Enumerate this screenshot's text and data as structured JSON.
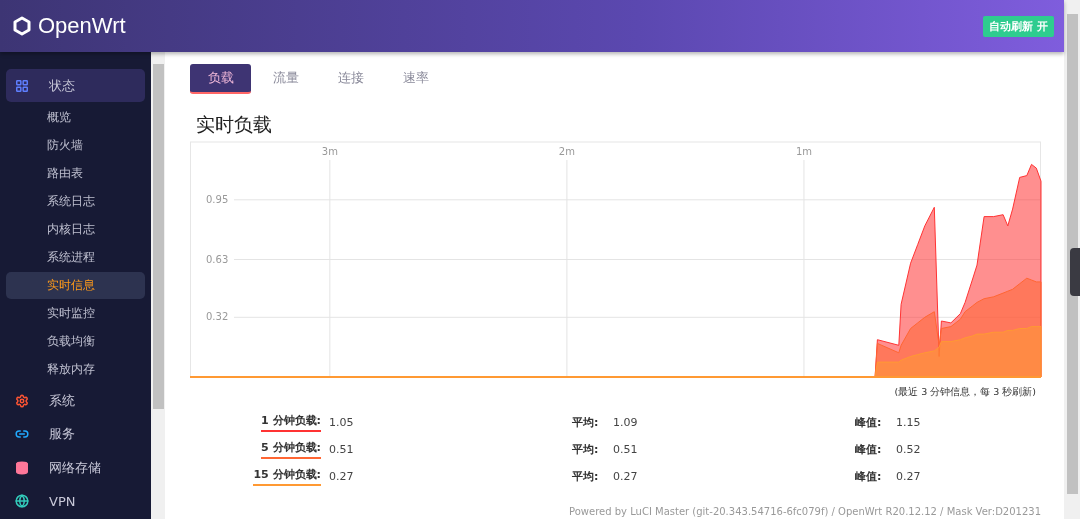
{
  "header": {
    "logo": "OpenWrt",
    "refresh_button": {
      "label": "自动刷新 开",
      "on": true
    }
  },
  "sidebar": {
    "items": [
      {
        "label": "状态",
        "kind": "grid",
        "expanded": true,
        "children": [
          {
            "label": "概览",
            "selected": false
          },
          {
            "label": "防火墙",
            "selected": false
          },
          {
            "label": "路由表",
            "selected": false
          },
          {
            "label": "系统日志",
            "selected": false
          },
          {
            "label": "内核日志",
            "selected": false
          },
          {
            "label": "系统进程",
            "selected": false
          },
          {
            "label": "实时信息",
            "selected": true
          },
          {
            "label": "实时监控",
            "selected": false
          },
          {
            "label": "负载均衡",
            "selected": false
          },
          {
            "label": "释放内存",
            "selected": false
          }
        ]
      },
      {
        "label": "系统",
        "kind": "gear",
        "expanded": false
      },
      {
        "label": "服务",
        "kind": "link",
        "expanded": false
      },
      {
        "label": "网络存储",
        "kind": "database",
        "expanded": false
      },
      {
        "label": "VPN",
        "kind": "globe",
        "expanded": false
      }
    ]
  },
  "tabs": [
    {
      "label": "负载",
      "selected": true
    },
    {
      "label": "流量",
      "selected": false
    },
    {
      "label": "连接",
      "selected": false
    },
    {
      "label": "速率",
      "selected": false
    }
  ],
  "title": "实时负载",
  "chart_data": {
    "type": "area",
    "grid": true,
    "xlim": [
      3.59,
      0
    ],
    "ylim": [
      0,
      1.26
    ],
    "xticks": [
      {
        "value": 3,
        "label": "3m"
      },
      {
        "value": 2,
        "label": "2m"
      },
      {
        "value": 1,
        "label": "1m"
      }
    ],
    "yticks": [
      {
        "value": 0.32,
        "label": "0.32"
      },
      {
        "value": 0.63,
        "label": "0.63"
      },
      {
        "value": 0.95,
        "label": "0.95"
      }
    ],
    "x": [
      3.59,
      0.7,
      0.69,
      0.6,
      0.59,
      0.55,
      0.52,
      0.49,
      0.45,
      0.43,
      0.42,
      0.38,
      0.34,
      0.32,
      0.29,
      0.27,
      0.24,
      0.2,
      0.16,
      0.14,
      0.12,
      0.09,
      0.06,
      0.04,
      0.02,
      0
    ],
    "series": [
      {
        "color": "#ff3333",
        "values": [
          0,
          0,
          0.2,
          0.17,
          0.39,
          0.61,
          0.71,
          0.81,
          0.91,
          0.11,
          0.3,
          0.29,
          0.34,
          0.4,
          0.52,
          0.6,
          0.86,
          0.86,
          0.87,
          0.81,
          0.9,
          1.07,
          1.08,
          1.14,
          1.12,
          1.05
        ]
      },
      {
        "color": "#ff6633",
        "values": [
          0,
          0,
          0.18,
          0.13,
          0.17,
          0.26,
          0.29,
          0.32,
          0.35,
          0.17,
          0.26,
          0.27,
          0.31,
          0.35,
          0.38,
          0.4,
          0.42,
          0.43,
          0.45,
          0.46,
          0.47,
          0.5,
          0.53,
          0.52,
          0.51,
          0.51
        ]
      },
      {
        "color": "#ff9933",
        "values": [
          0,
          0,
          0.08,
          0.08,
          0.09,
          0.11,
          0.12,
          0.13,
          0.14,
          0.16,
          0.19,
          0.19,
          0.2,
          0.21,
          0.22,
          0.23,
          0.23,
          0.24,
          0.24,
          0.25,
          0.25,
          0.26,
          0.26,
          0.27,
          0.27,
          0.27
        ]
      }
    ]
  },
  "chart_note": "(最近 3 分钟信息，每 3 秒刷新)",
  "stats": [
    {
      "label": "1 分钟负载:",
      "value": "1.05",
      "avg_label": "平均:",
      "avg": "1.09",
      "peak_label": "峰值:",
      "peak": "1.15",
      "color": "#ff3333"
    },
    {
      "label": "5 分钟负载:",
      "value": "0.51",
      "avg_label": "平均:",
      "avg": "0.51",
      "peak_label": "峰值:",
      "peak": "0.52",
      "color": "#ff6633"
    },
    {
      "label": "15 分钟负载:",
      "value": "0.27",
      "avg_label": "平均:",
      "avg": "0.27",
      "peak_label": "峰值:",
      "peak": "0.27",
      "color": "#ff9933"
    }
  ],
  "footer": "Powered by LuCI Master (git-20.343.54716-6fc079f) / OpenWrt R20.12.12 / Mask Ver:D201231"
}
